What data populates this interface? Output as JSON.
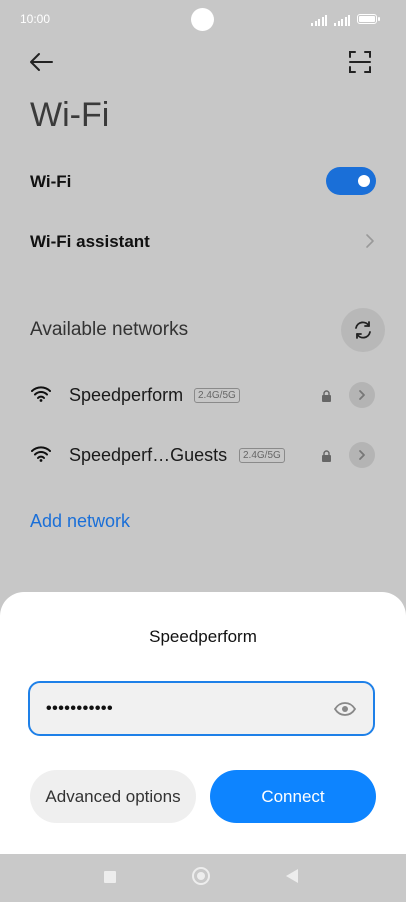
{
  "status_bar": {
    "time": "10:00",
    "battery": "100"
  },
  "header": {
    "title": "Wi-Fi"
  },
  "settings": {
    "wifi_label": "Wi-Fi",
    "wifi_enabled": true,
    "assistant_label": "Wi-Fi assistant"
  },
  "networks": {
    "section_label": "Available networks",
    "items": [
      {
        "name": "Speedperform",
        "band": "2.4G/5G",
        "secured": true
      },
      {
        "name": "Speedperf…Guests",
        "band": "2.4G/5G",
        "secured": true
      }
    ],
    "add_label": "Add network"
  },
  "dialog": {
    "title": "Speedperform",
    "password_value": "•••••••••••",
    "advanced_label": "Advanced options",
    "connect_label": "Connect"
  },
  "colors": {
    "accent": "#1a6fd8",
    "connect": "#0d84ff"
  }
}
